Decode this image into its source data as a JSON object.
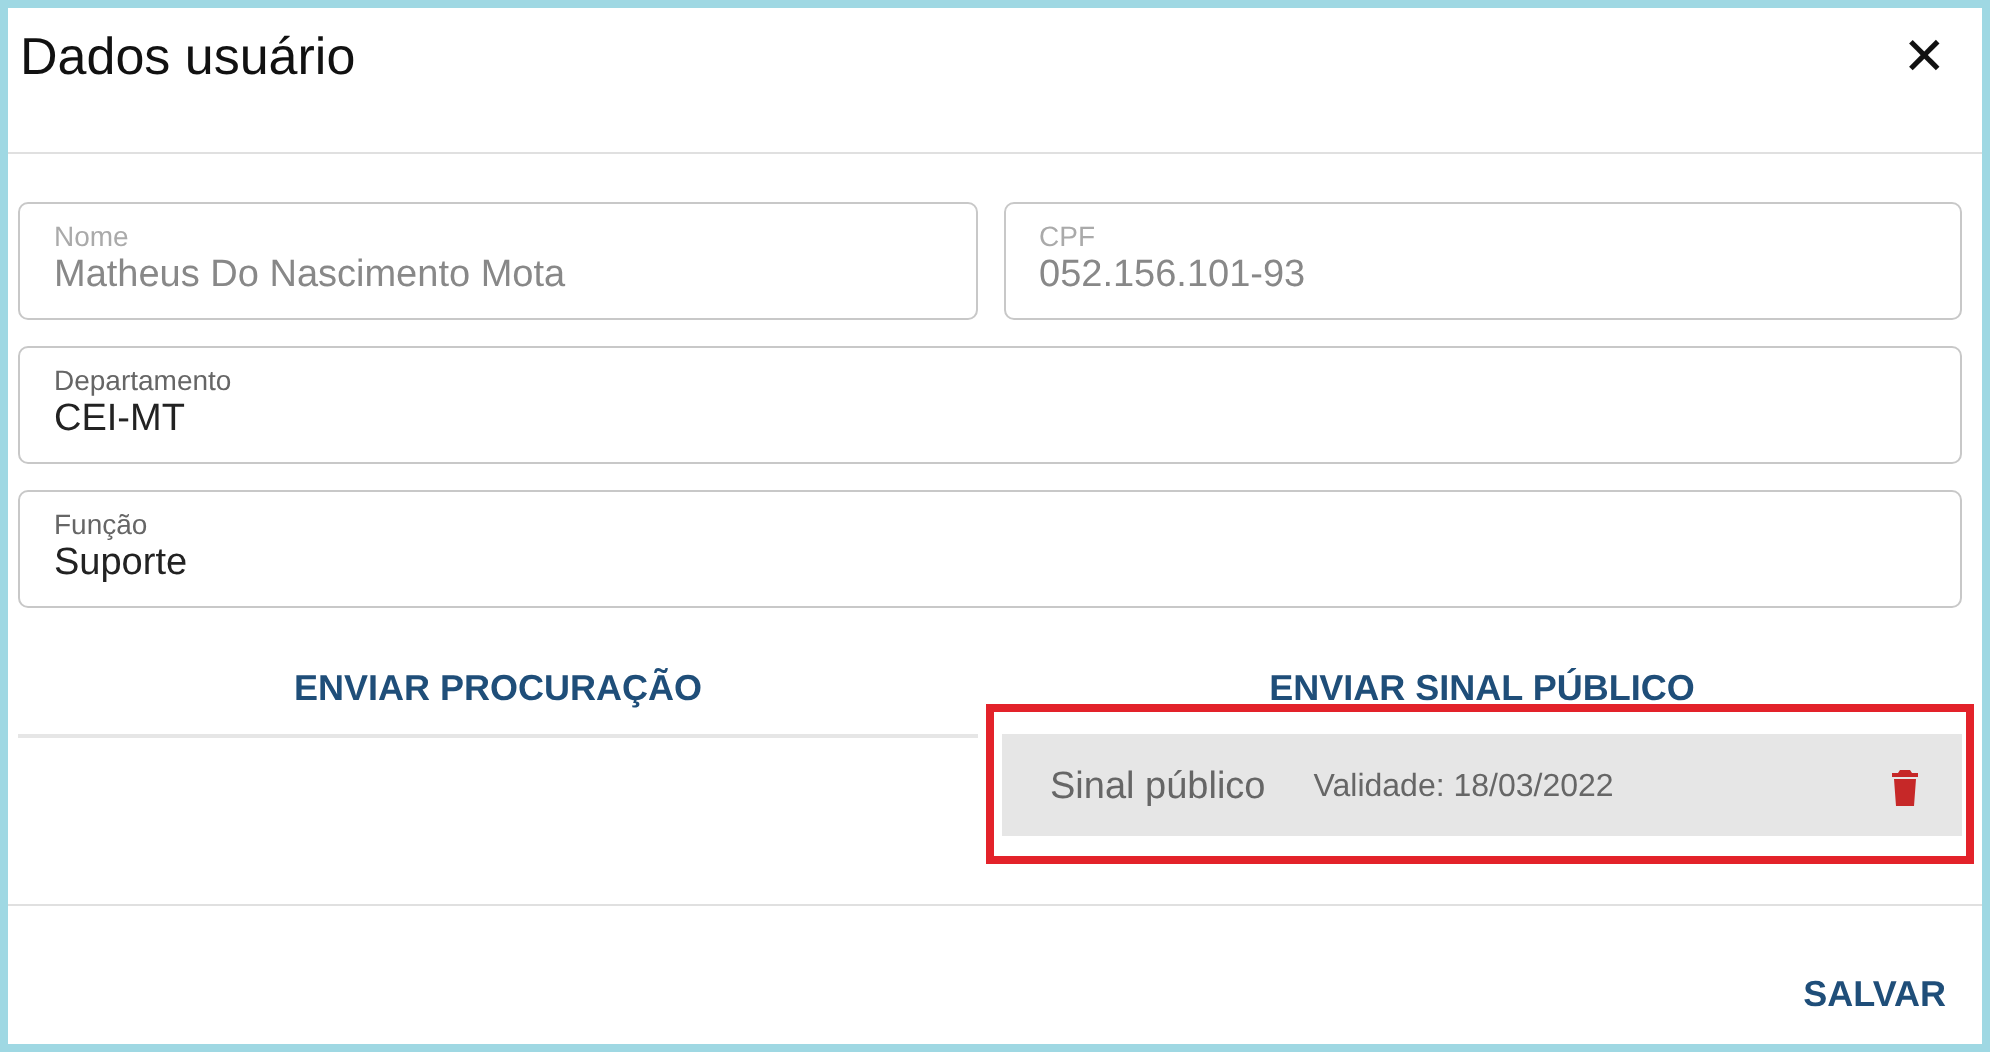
{
  "dialog": {
    "title": "Dados usuário",
    "close_icon": "✕"
  },
  "fields": [
    {
      "label": "Nome",
      "value": "Matheus Do Nascimento Mota",
      "disabled": true
    },
    {
      "label": "CPF",
      "value": "052.156.101-93",
      "disabled": true
    },
    {
      "label": "Departamento",
      "value": "CEI-MT",
      "disabled": false
    },
    {
      "label": "Função",
      "value": "Suporte",
      "disabled": false
    }
  ],
  "upload_buttons": [
    "ENVIAR PROCURAÇÃO",
    "ENVIAR SINAL PÚBLICO"
  ],
  "documents": [
    {
      "name": "Sinal público",
      "validity": "Validade: 18/03/2022"
    }
  ],
  "highlight": true,
  "footer": {
    "save_button": "SALVAR"
  }
}
